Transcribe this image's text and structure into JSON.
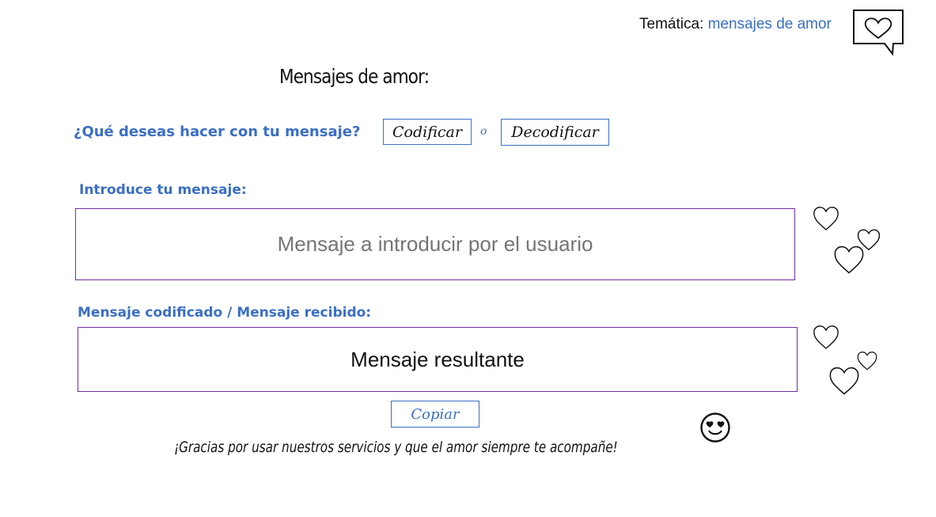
{
  "header": {
    "theme_label": "Temática:",
    "theme_value": "mensajes de amor",
    "theme_icon": "heart-speech-bubble-icon"
  },
  "main": {
    "title": "Mensajes de amor:",
    "question": "¿Qué deseas hacer con tu mensaje?",
    "encode_label": "Codificar",
    "or_label": "o",
    "decode_label": "Decodificar",
    "input_label": "Introduce tu mensaje:",
    "input_placeholder": "Mensaje a introducir por el usuario",
    "output_label": "Mensaje codificado / Mensaje recibido:",
    "output_text": "Mensaje resultante",
    "copy_label": "Copiar",
    "thanks_text": "¡Gracias por usar nuestros servicios y que el amor siempre te acompañe!"
  },
  "decorations": {
    "hearts_icon": "heart-icon",
    "smiley_icon": "heart-eyes-smiley-icon"
  },
  "colors": {
    "accent_blue": "#3b6fc4",
    "box_border_purple": "#7030a0"
  }
}
